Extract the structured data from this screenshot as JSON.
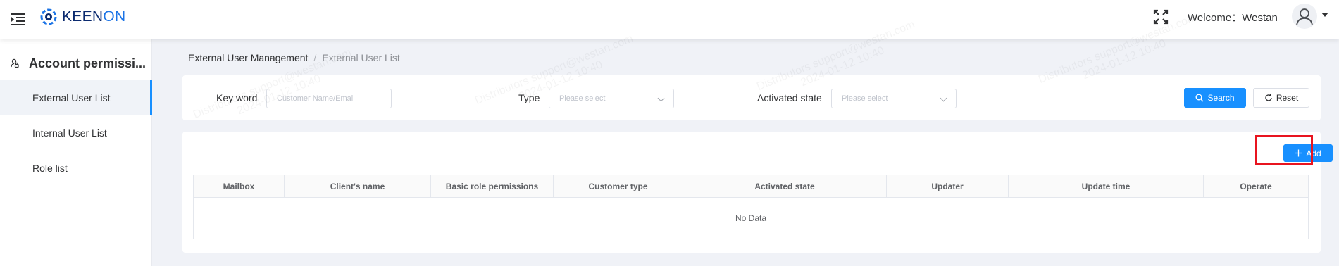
{
  "header": {
    "logo_text_prefix": "KEEN",
    "logo_text_suffix": "ON",
    "welcome": "Welcome：Westan"
  },
  "sidebar": {
    "section_title": "Account permissi...",
    "items": [
      {
        "label": "External User List",
        "active": true
      },
      {
        "label": "Internal User List",
        "active": false
      },
      {
        "label": "Role list",
        "active": false
      }
    ]
  },
  "breadcrumb": {
    "parent": "External User Management",
    "separator": "/",
    "current": "External User List"
  },
  "filters": {
    "keyword_label": "Key word",
    "keyword_placeholder": "Customer Name/Email",
    "type_label": "Type",
    "type_placeholder": "Please select",
    "activated_label": "Activated state",
    "activated_placeholder": "Please select",
    "search_button": "Search",
    "reset_button": "Reset"
  },
  "table": {
    "add_button": "Add",
    "columns": [
      "Mailbox",
      "Client's name",
      "Basic role permissions",
      "Customer type",
      "Activated state",
      "Updater",
      "Update time",
      "Operate"
    ],
    "empty_text": "No Data"
  },
  "watermark": {
    "line1": "Distributors support@westan.com",
    "line2": "2024-01-12 10:40"
  },
  "colors": {
    "primary": "#1890ff",
    "highlight": "#e8141f",
    "logo_dark": "#0b2a6f",
    "logo_blue": "#1c74e6"
  }
}
